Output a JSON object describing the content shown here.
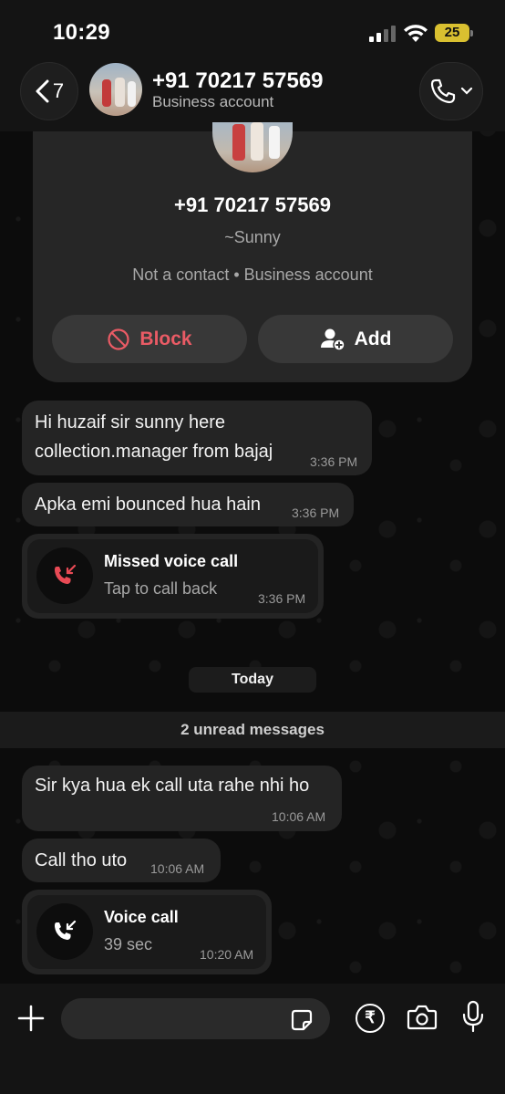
{
  "status_bar": {
    "time": "10:29",
    "battery": "25"
  },
  "header": {
    "back_count": "7",
    "contact_name": "+91 70217 57569",
    "contact_subtitle": "Business account"
  },
  "profile_card": {
    "phone": "+91 70217 57569",
    "alias": "~Sunny",
    "status": "Not a contact • Business account",
    "block_label": "Block",
    "add_label": "Add"
  },
  "messages": [
    {
      "type": "text",
      "text_line1": "Hi huzaif sir sunny here",
      "text_line2": "collection.manager from bajaj",
      "time": "3:36 PM"
    },
    {
      "type": "text",
      "text": "Apka emi bounced hua hain",
      "time": "3:36 PM"
    },
    {
      "type": "call",
      "title": "Missed voice call",
      "subtitle": "Tap to call back",
      "time": "3:36 PM",
      "status": "missed"
    },
    {
      "type": "text",
      "text": "Sir kya hua ek call uta rahe nhi ho",
      "time": "10:06 AM"
    },
    {
      "type": "text",
      "text": "Call tho uto",
      "time": "10:06 AM"
    },
    {
      "type": "call",
      "title": "Voice call",
      "subtitle": "39 sec",
      "time": "10:20 AM",
      "status": "incoming"
    }
  ],
  "date_separator": "Today",
  "unread_banner": "2 unread messages",
  "composer": {
    "placeholder": ""
  },
  "colors": {
    "background": "#0c0c0c",
    "bubble": "#242424",
    "block_red": "#ea5b65",
    "missed_call_red": "#e84a55",
    "battery_yellow": "#d9c030"
  },
  "icons": [
    "back-chevron-icon",
    "phone-icon",
    "chevron-down-icon",
    "block-icon",
    "add-person-icon",
    "missed-call-icon",
    "incoming-call-icon",
    "plus-icon",
    "sticker-icon",
    "rupee-icon",
    "camera-icon",
    "microphone-icon"
  ]
}
